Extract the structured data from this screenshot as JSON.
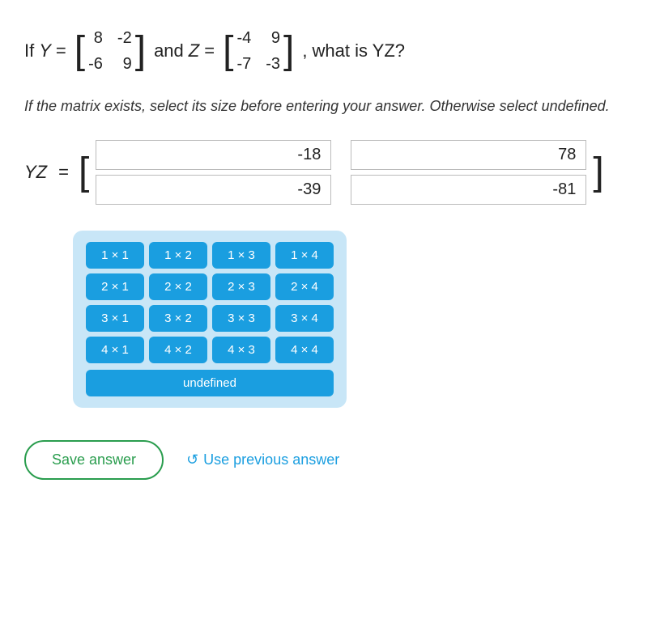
{
  "problem": {
    "if_label": "If",
    "Y_label": "Y",
    "equals": "=",
    "and_label": "and",
    "Z_label": "Z",
    "comma": ",",
    "question": "what is YZ?",
    "Y_matrix": [
      [
        "8",
        "-2"
      ],
      [
        "-6",
        "9"
      ]
    ],
    "Z_matrix": [
      [
        "-4",
        "9"
      ],
      [
        "-7",
        "-3"
      ]
    ]
  },
  "instructions": "If the matrix exists, select its size before entering your answer. Otherwise select undefined.",
  "answer": {
    "YZ_label": "YZ",
    "eq": "=",
    "cells": [
      [
        "-18",
        "78"
      ],
      [
        "-39",
        "-81"
      ]
    ]
  },
  "size_selector": {
    "buttons": [
      [
        "1 × 1",
        "1 × 2",
        "1 × 3",
        "1 × 4"
      ],
      [
        "2 × 1",
        "2 × 2",
        "2 × 3",
        "2 × 4"
      ],
      [
        "3 × 1",
        "3 × 2",
        "3 × 3",
        "3 × 4"
      ],
      [
        "4 × 1",
        "4 × 2",
        "4 × 3",
        "4 × 4"
      ]
    ],
    "undefined_label": "undefined"
  },
  "bottom": {
    "save_label": "Save answer",
    "use_prev_label": "Use previous answer"
  }
}
